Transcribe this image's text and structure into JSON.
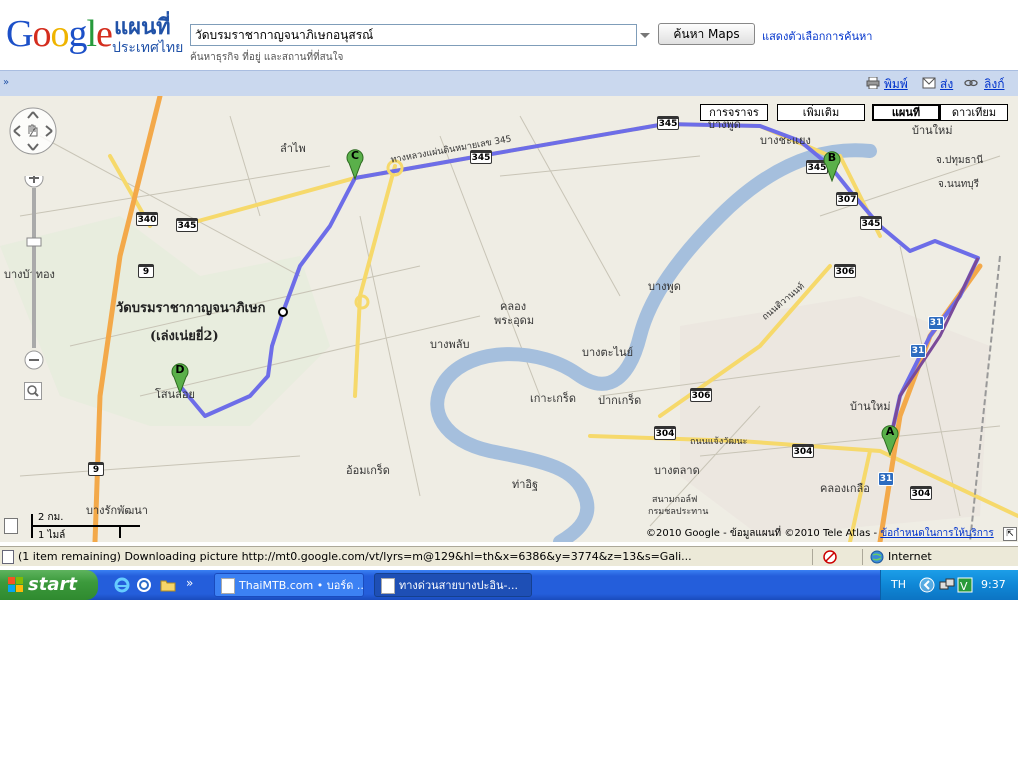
{
  "header": {
    "logo_text": "Google",
    "logo_maps": "แผนที่",
    "logo_country": "ประเทศไทย",
    "search_value": "วัดบรมราชากาญจนาภิเษกอนุสรณ์",
    "search_hint": "ค้นหาธุรกิจ ที่อยู่ และสถานที่ที่สนใจ",
    "search_button": "ค้นหา Maps",
    "search_options": "แสดงตัวเลือกการค้นหา"
  },
  "toolbar": {
    "toggle": "»",
    "print": "พิมพ์",
    "send": "ส่ง",
    "link": "ลิงก์"
  },
  "map": {
    "type_buttons": [
      "การจราจร",
      "เพิ่มเติม",
      "แผนที่",
      "ดาวเทียม"
    ],
    "active_type": "แผนที่",
    "markers": [
      "A",
      "B",
      "C",
      "D"
    ],
    "place_labels": {
      "lamphai": "ลำไพ",
      "bang_bua_thong": "บางบัวทอง",
      "wat": "วัดบรมราชากาญจนาภิเษก",
      "wat_sub": "(เล่งเน่ยยี่2)",
      "sano_loi": "โสนลอย",
      "bang_rak_phatthana": "บางรักพัฒนา",
      "khlong_phra_udom": "คลอง",
      "khlong_phra_udom2": "พระอุดม",
      "bang_phlap": "บางพลับ",
      "bang_tanai": "บางตะไนย์",
      "ko_kret": "เกาะเกร็ด",
      "pak_kret": "ปากเกร็ด",
      "bang_phut": "บางพูด",
      "om_kret": "อ้อมเกร็ด",
      "tha_it": "ท่าอิฐ",
      "bang_talat": "บางตลาด",
      "khlong_kluea": "คลองเกลือ",
      "ban_mai": "บ้านใหม่",
      "ban_mai2": "บ้านใหม่",
      "bang_khayaeng": "บางชะแยง",
      "bang_phut_top": "บางพูด",
      "pathum": "จ.ปทุมธานี",
      "nonthaburi": "จ.นนทบุรี",
      "road_345": "ทางหลวงแผ่นดินหมายเลข 345",
      "road_chaeng": "ถนนแจ้งวัฒนะ",
      "road_tiwanon": "ถนนติวานนท์",
      "stadium": "สนามกอล์ฟ",
      "stadium2": "กรมชลประทาน"
    },
    "shields": [
      "345",
      "345",
      "345",
      "345",
      "340",
      "9",
      "9",
      "307",
      "345",
      "306",
      "306",
      "304",
      "304",
      "304",
      "31",
      "31",
      "31"
    ],
    "scale_km": "2 กม.",
    "scale_mi": "1 ไมล์",
    "copyright": "©2010 Google - ข้อมูลแผนที่ ©2010 Tele Atlas -",
    "terms": "ข้อกำหนดในการให้บริการ"
  },
  "statusbar": {
    "text": "(1 item remaining) Downloading picture http://mt0.google.com/vt/lyrs=m@129&hl=th&x=6386&y=3774&z=13&s=Gali...",
    "zone": "Internet"
  },
  "taskbar": {
    "start": "start",
    "tasks": [
      "ThaiMTB.com • บอร์ด ...",
      "ทางด่วนสายบางปะอิน-..."
    ],
    "lang": "TH",
    "clock": "9:37"
  },
  "colors": {
    "google_blue": "#2152a8",
    "toolbar_bg": "#cad8ee",
    "route": "#6d6de8",
    "river": "#a5bfdd",
    "taskbar": "#245edb"
  }
}
